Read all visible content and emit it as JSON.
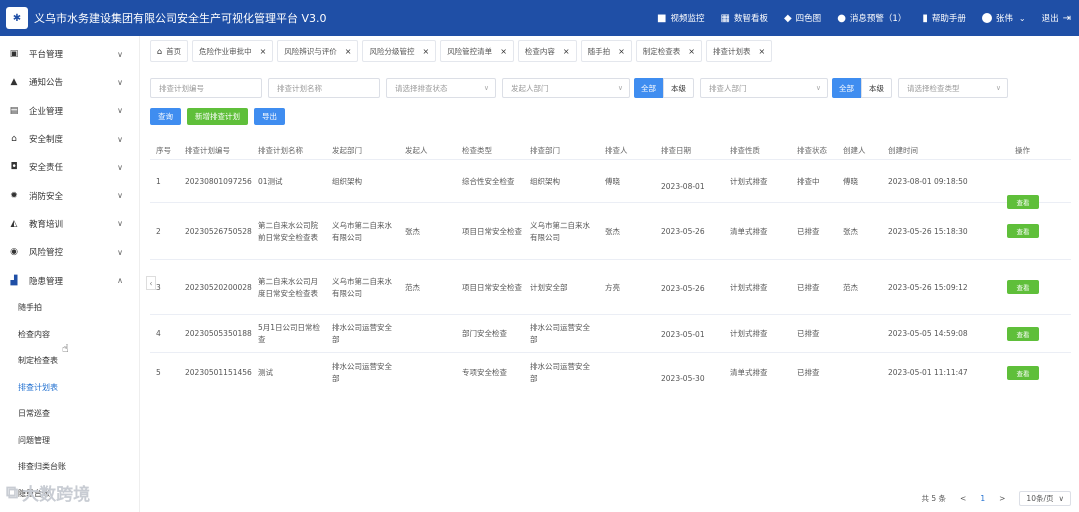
{
  "header": {
    "title": "义乌市水务建设集团有限公司安全生产可视化管理平台  V3.0",
    "items": [
      {
        "icon": "video-icon",
        "label": "视频监控"
      },
      {
        "icon": "dashboard-icon",
        "label": "数智看板"
      },
      {
        "icon": "cube-icon",
        "label": "四色图"
      },
      {
        "icon": "bell-icon",
        "label": "消息预警（1）"
      },
      {
        "icon": "book-icon",
        "label": "帮助手册"
      },
      {
        "icon": "user-icon",
        "label": "张伟"
      },
      {
        "icon": "logout-icon",
        "label": "退出"
      }
    ]
  },
  "sidebar": {
    "items": [
      {
        "label": "平台管理",
        "icon": "monitor-icon"
      },
      {
        "label": "通知公告",
        "icon": "bell-icon"
      },
      {
        "label": "企业管理",
        "icon": "building-icon"
      },
      {
        "label": "安全制度",
        "icon": "bank-icon"
      },
      {
        "label": "安全责任",
        "icon": "shield-icon"
      },
      {
        "label": "消防安全",
        "icon": "gear-icon"
      },
      {
        "label": "教育培训",
        "icon": "graduation-icon"
      },
      {
        "label": "风险管控",
        "icon": "target-icon"
      },
      {
        "label": "隐患管理",
        "icon": "chart-icon"
      }
    ],
    "sub_items": [
      "随手拍",
      "检查内容",
      "制定检查表",
      "排查计划表",
      "日常巡查",
      "问题管理",
      "排查归类台账",
      "隐患台账"
    ]
  },
  "tabs": [
    {
      "label": "首页"
    },
    {
      "label": "危险作业审批中"
    },
    {
      "label": "风险辨识与评价"
    },
    {
      "label": "风险分级管控"
    },
    {
      "label": "风险管控清单"
    },
    {
      "label": "检查内容"
    },
    {
      "label": "随手拍"
    },
    {
      "label": "制定检查表"
    },
    {
      "label": "排查计划表"
    }
  ],
  "filters": {
    "plan_no": "排查计划编号",
    "plan_name": "排查计划名称",
    "plan_status": "请选择排查状态",
    "dept": "发起人部门",
    "seg_all": "全部",
    "seg_level": "本级",
    "check_dept": "排查人部门",
    "check_type": "请选择检查类型"
  },
  "actions": {
    "query": "查询",
    "add": "新增排查计划",
    "export": "导出"
  },
  "table": {
    "columns": [
      "序号",
      "排查计划编号",
      "排查计划名称",
      "发起部门",
      "发起人",
      "检查类型",
      "排查部门",
      "排查人",
      "排查日期",
      "排查性质",
      "排查状态",
      "创建人",
      "创建时间",
      "操作"
    ],
    "rows": [
      {
        "idx": "1",
        "no": "20230801097256",
        "name": "01测试",
        "dept": "组织架构",
        "initiator": "",
        "type": "综合性安全检查",
        "check_dept": "组织架构",
        "checker": "傅晓",
        "date": "2023-08-01",
        "nature": "计划式排查",
        "status": "排查中",
        "creator": "傅晓",
        "created": "2023-08-01 09:18:50",
        "op": "查看"
      },
      {
        "idx": "2",
        "no": "20230526750528",
        "name": "第二自来水公司院前日常安全检查表",
        "dept": "义乌市第二自来水有限公司",
        "initiator": "张杰",
        "type": "项目日常安全检查",
        "check_dept": "义乌市第二自来水有限公司",
        "checker": "张杰",
        "date": "2023-05-26",
        "nature": "清单式排查",
        "status": "已排查",
        "creator": "张杰",
        "created": "2023-05-26 15:18:30",
        "op": "查看"
      },
      {
        "idx": "3",
        "no": "20230520200028",
        "name": "第二自来水公司月度日常安全检查表",
        "dept": "义乌市第二自来水有限公司",
        "initiator": "范杰",
        "type": "项目日常安全检查",
        "check_dept": "计划安全部",
        "checker": "方亮",
        "date": "2023-05-26",
        "nature": "计划式排查",
        "status": "已排查",
        "creator": "范杰",
        "created": "2023-05-26 15:09:12",
        "op": "查看"
      },
      {
        "idx": "4",
        "no": "20230505350188",
        "name": "5月1日公司日常检查",
        "dept": "排水公司运营安全部",
        "initiator": "",
        "type": "部门安全检查",
        "check_dept": "排水公司运营安全部",
        "checker": "",
        "date": "2023-05-01",
        "nature": "计划式排查",
        "status": "已排查",
        "creator": "",
        "created": "2023-05-05 14:59:08",
        "op": "查看"
      },
      {
        "idx": "5",
        "no": "20230501151456",
        "name": "测试",
        "dept": "排水公司运营安全部",
        "initiator": "",
        "type": "专项安全检查",
        "check_dept": "排水公司运营安全部",
        "checker": "",
        "date": "2023-05-30",
        "nature": "清单式排查",
        "status": "已排查",
        "creator": "",
        "created": "2023-05-01 11:11:47",
        "op": "查看"
      }
    ]
  },
  "pagination": {
    "total": "共 5 条",
    "prev": "<",
    "page": "1",
    "next": ">",
    "size": "10条/页"
  },
  "watermark": "大数跨境",
  "colors": {
    "header": "#1f4fa6",
    "primary": "#3f8df0",
    "success": "#5fbf3a"
  }
}
